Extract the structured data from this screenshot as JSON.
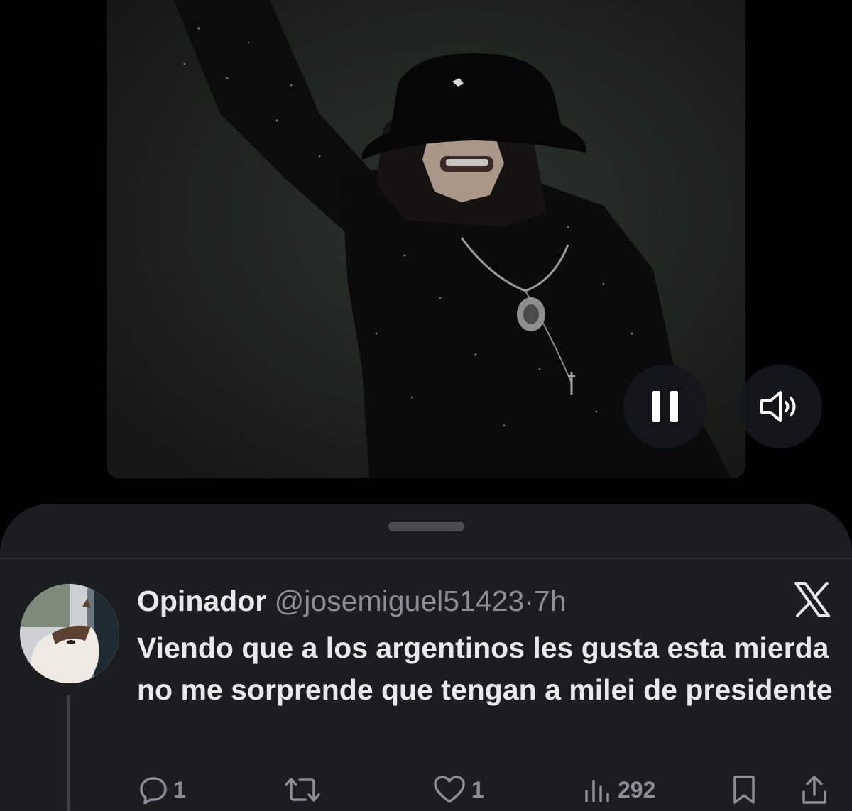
{
  "tweet": {
    "display_name": "Opinador",
    "handle": "@josemiguel51423",
    "separator": "·",
    "time": "7h",
    "text": "Viendo que a los argentinos les gusta esta mierda no me sorprende que tengan a milei de presidente"
  },
  "actions": {
    "replies": "1",
    "retweets": "",
    "likes": "1",
    "views": "292"
  },
  "video": {
    "state": "playing"
  },
  "icons": {
    "pause": "pause-icon",
    "volume": "volume-icon",
    "platform": "x-logo-icon",
    "reply": "reply-icon",
    "retweet": "retweet-icon",
    "like": "heart-icon",
    "views": "views-icon",
    "bookmark": "bookmark-icon",
    "share": "share-icon"
  },
  "colors": {
    "background": "#000000",
    "sheet": "#1c1d1f",
    "text_primary": "#e7e9ea",
    "text_secondary": "#8b8f95"
  }
}
